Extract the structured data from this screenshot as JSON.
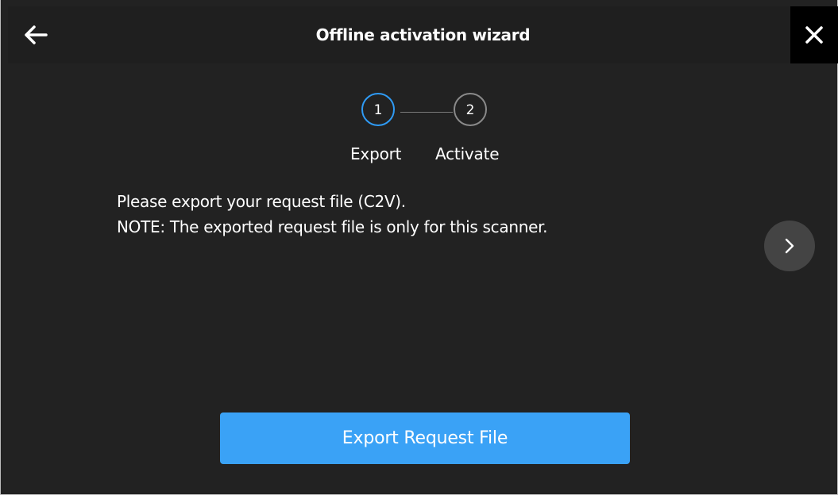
{
  "window": {
    "title": "Offline activation wizard"
  },
  "stepper": {
    "steps": [
      {
        "number": "1",
        "label": "Export",
        "active": true
      },
      {
        "number": "2",
        "label": "Activate",
        "active": false
      }
    ]
  },
  "content": {
    "line1": "Please export your request file (C2V).",
    "line2": "NOTE: The exported request file is only for this scanner."
  },
  "actions": {
    "export_label": "Export Request File"
  },
  "icons": {
    "back": "arrow-left-icon",
    "close": "close-icon",
    "next": "chevron-right-icon"
  },
  "colors": {
    "background": "#222222",
    "header": "#1f1f1f",
    "accent": "#3aa2f6",
    "active_step_border": "#2f9bf5"
  }
}
